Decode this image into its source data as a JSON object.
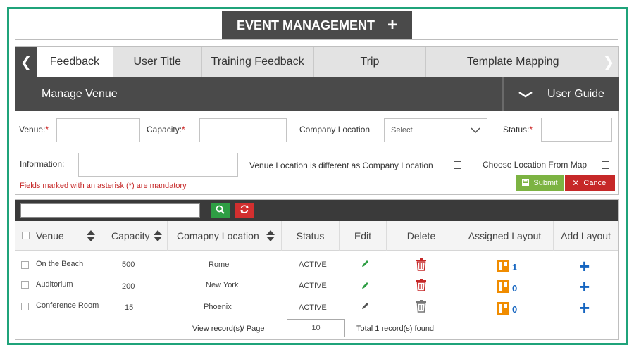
{
  "header": {
    "title": "EVENT MANAGEMENT",
    "add_icon": "plus-icon"
  },
  "tabs": [
    {
      "label": "Feedback",
      "active": true
    },
    {
      "label": "User Title",
      "active": false
    },
    {
      "label": "Training Feedback",
      "active": false
    },
    {
      "label": "Trip",
      "active": false
    },
    {
      "label": "Template Mapping",
      "active": false
    }
  ],
  "section": {
    "title": "Manage Venue",
    "guide_label": "User Guide"
  },
  "form": {
    "venue_label": "Venue:",
    "capacity_label": "Capacity:",
    "company_location_label": "Company Location",
    "company_location_value": "Select",
    "status_label": "Status:",
    "information_label": "Information:",
    "venue_diff_label": "Venue Location is different as Company Location",
    "choose_map_label": "Choose Location From Map",
    "asterisk": "*",
    "mandatory_note": "Fields marked with an asterisk (*) are mandatory",
    "submit_label": "Submit",
    "cancel_label": "Cancel"
  },
  "table": {
    "headers": {
      "venue": "Venue",
      "capacity": "Capacity",
      "company_location": "Comapny Location",
      "status": "Status",
      "edit": "Edit",
      "delete": "Delete",
      "assigned_layout": "Assigned Layout",
      "add_layout": "Add Layout"
    },
    "rows": [
      {
        "venue": "On the Beach",
        "capacity": "500",
        "location": "Rome",
        "status": "ACTIVE",
        "layouts": "1"
      },
      {
        "venue": "Auditorium",
        "capacity": "200",
        "location": "New York",
        "status": "ACTIVE",
        "layouts": "0"
      },
      {
        "venue": "Conference Room",
        "capacity": "15",
        "location": "Phoenix",
        "status": "ACTIVE",
        "layouts": "0"
      }
    ],
    "pager": {
      "page_label": "View record(s)/ Page",
      "page_size": "10",
      "total_label": "Total 1 record(s) found"
    }
  },
  "colors": {
    "frame": "#1fa37a",
    "dark_bar": "#4a4a4a",
    "submit": "#7cb342",
    "cancel": "#c62828",
    "search_button": "#2e9e44",
    "refresh_button": "#d32f2f",
    "edit_active": "#2e9e44",
    "delete_active": "#c62828",
    "layout_icon": "#f08c00",
    "link_blue": "#1565c0"
  }
}
